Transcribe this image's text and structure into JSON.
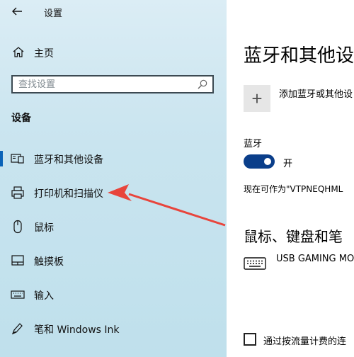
{
  "window": {
    "title": "设置"
  },
  "sidebar": {
    "home_label": "主页",
    "search_placeholder": "查找设置",
    "section_title": "设备",
    "items": [
      {
        "label": "蓝牙和其他设备",
        "icon": "bluetooth-devices-icon",
        "selected": true
      },
      {
        "label": "打印机和扫描仪",
        "icon": "printer-icon",
        "selected": false
      },
      {
        "label": "鼠标",
        "icon": "mouse-icon",
        "selected": false
      },
      {
        "label": "触摸板",
        "icon": "touchpad-icon",
        "selected": false
      },
      {
        "label": "输入",
        "icon": "keyboard-icon",
        "selected": false
      },
      {
        "label": "笔和 Windows Ink",
        "icon": "pen-icon",
        "selected": false
      }
    ]
  },
  "main": {
    "title": "蓝牙和其他设",
    "add_device_label": "添加蓝牙或其他设",
    "bluetooth": {
      "heading": "蓝牙",
      "state_label": "开",
      "on": true
    },
    "discoverable_text": "现在可作为\"VTPNEQHML",
    "mouse_section_title": "鼠标、键盘和笔",
    "devices": [
      {
        "name": "USB GAMING MO",
        "icon": "keyboard-icon"
      }
    ],
    "metered_label": "通过按流量计费的连"
  },
  "colors": {
    "accent": "#0a63b8",
    "toggle_on": "#0a3e8a",
    "annotation_arrow": "#e8453c"
  }
}
